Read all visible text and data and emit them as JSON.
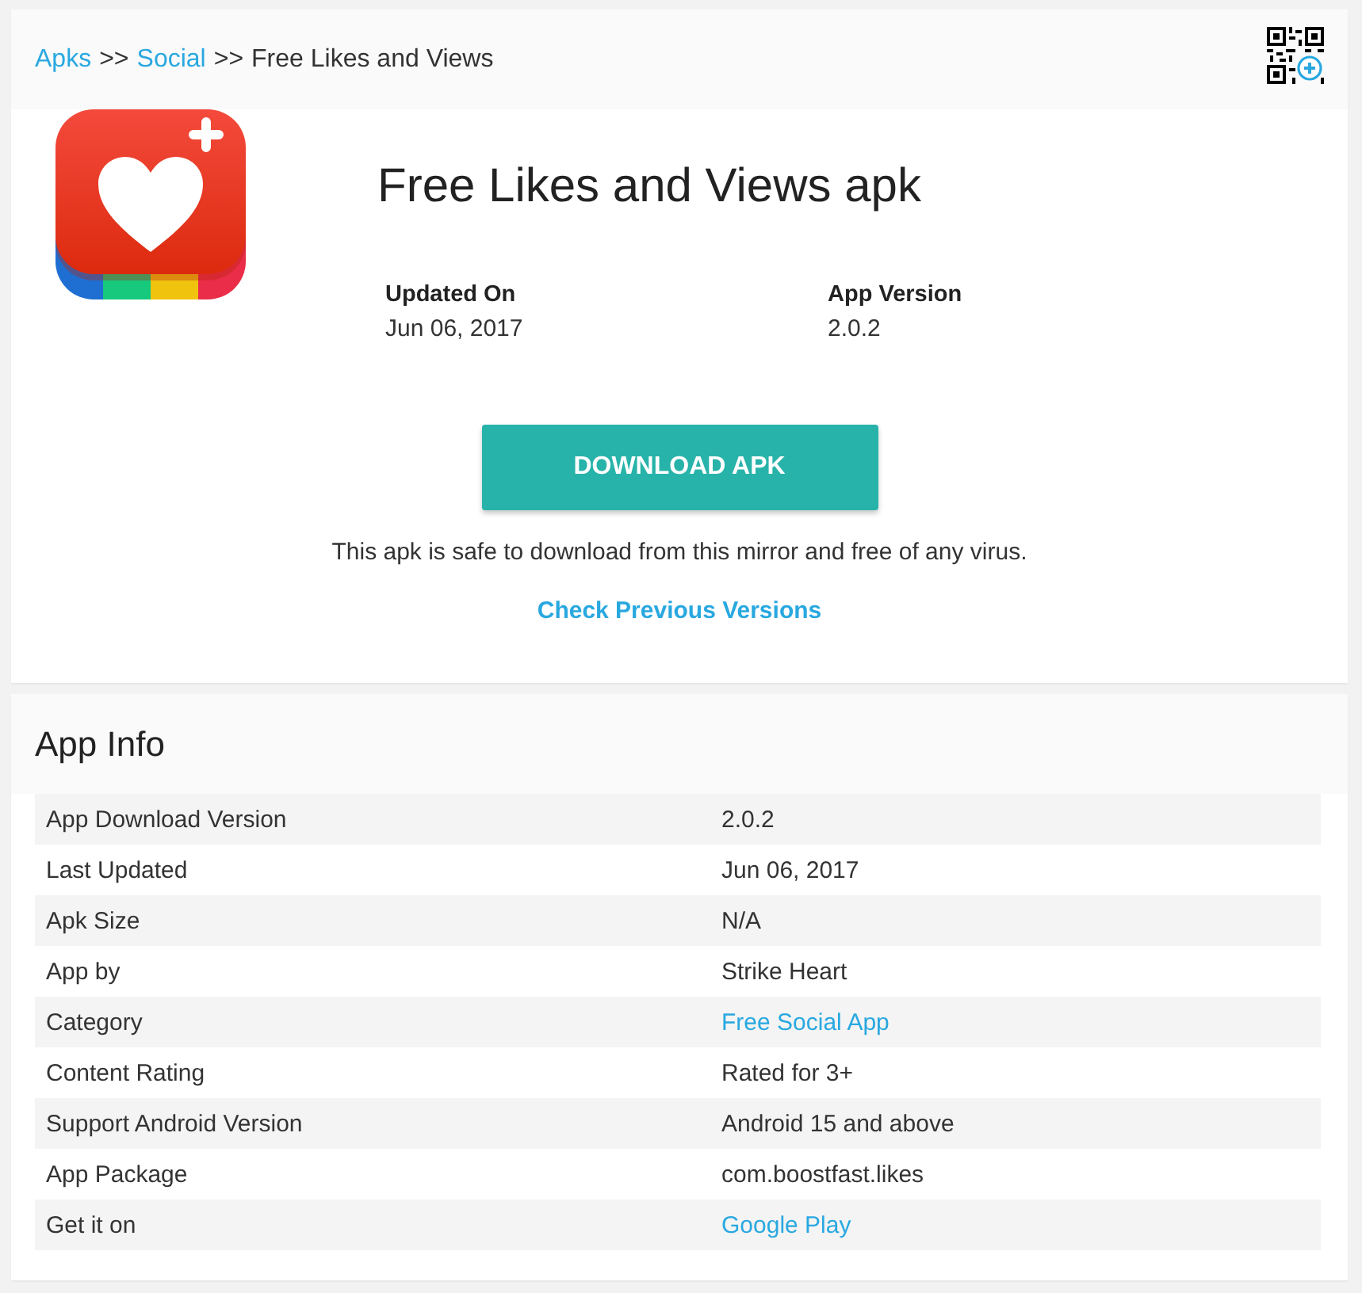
{
  "breadcrumb": [
    {
      "kind": "link",
      "label": "Apks"
    },
    {
      "kind": "separator",
      "label": ">>"
    },
    {
      "kind": "link",
      "label": "Social"
    },
    {
      "kind": "separator",
      "label": ">>"
    },
    {
      "kind": "current",
      "label": "Free Likes and Views"
    }
  ],
  "app": {
    "title": "Free Likes and Views apk",
    "facts": [
      {
        "label": "Updated On",
        "value": "Jun 06, 2017"
      },
      {
        "label": "App Version",
        "value": "2.0.2"
      }
    ],
    "download_button": "DOWNLOAD APK",
    "safety_note": "This apk is safe to download from this mirror and free of any virus.",
    "previous_versions_link": "Check Previous Versions"
  },
  "app_info": {
    "title": "App Info",
    "rows": [
      {
        "label": "App Download Version",
        "value": "2.0.2",
        "kind": "text"
      },
      {
        "label": "Last Updated",
        "value": "Jun 06, 2017",
        "kind": "text"
      },
      {
        "label": "Apk Size",
        "value": "N/A",
        "kind": "text"
      },
      {
        "label": "App by",
        "value": "Strike Heart",
        "kind": "text"
      },
      {
        "label": "Category",
        "value": "Free Social App",
        "kind": "link"
      },
      {
        "label": "Content Rating",
        "value": "Rated for 3+",
        "kind": "text"
      },
      {
        "label": "Support Android Version",
        "value": "Android 15 and above",
        "kind": "text"
      },
      {
        "label": "App Package",
        "value": "com.boostfast.likes",
        "kind": "text"
      },
      {
        "label": "Get it on",
        "value": "Google Play",
        "kind": "link"
      }
    ]
  }
}
